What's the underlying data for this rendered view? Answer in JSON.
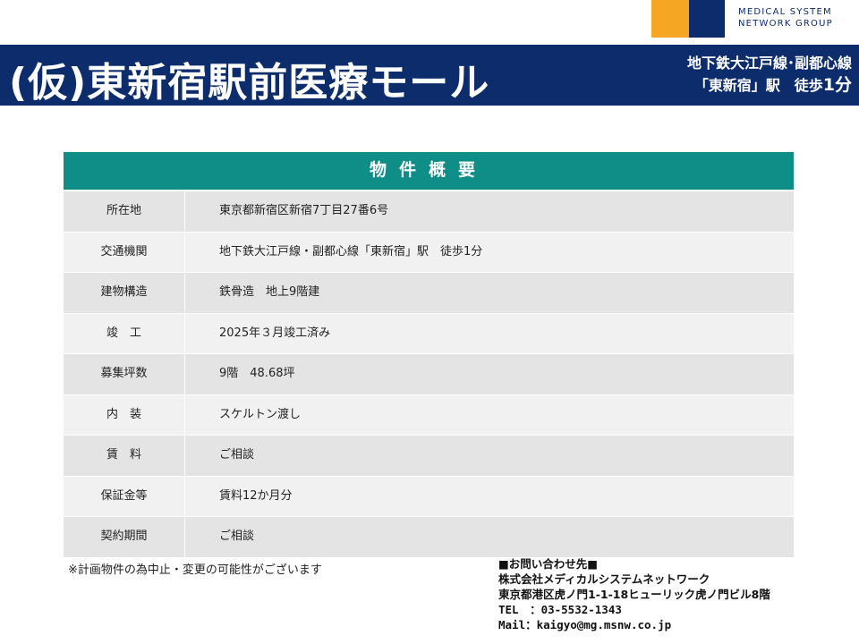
{
  "logo": {
    "line1": "MEDICAL SYSTEM",
    "line2": "NETWORK GROUP",
    "colors": {
      "orange": "#F5A623",
      "navy": "#0D2C6C"
    }
  },
  "banner": {
    "title": "(仮)東新宿駅前医療モール",
    "access_line1": "地下鉄大江戸線･副都心線",
    "access_line2_station": "「東新宿」駅　徒歩",
    "access_line2_minutes": "1分",
    "color": "#0D2C6C"
  },
  "table": {
    "header": "物件概要",
    "header_color": "#0E8E86",
    "rows": [
      {
        "label": "所在地",
        "value": "東京都新宿区新宿7丁目27番6号"
      },
      {
        "label": "交通機関",
        "value": "地下鉄大江戸線・副都心線「東新宿」駅　徒歩1分"
      },
      {
        "label": "建物構造",
        "value": "鉄骨造　地上9階建"
      },
      {
        "label": "竣　工",
        "value": "2025年３月竣工済み"
      },
      {
        "label": "募集坪数",
        "value": "9階　48.68坪"
      },
      {
        "label": "内　装",
        "value": "スケルトン渡し"
      },
      {
        "label": "賃　料",
        "value": "ご相談"
      },
      {
        "label": "保証金等",
        "value": "賃料12か月分"
      },
      {
        "label": "契約期間",
        "value": "ご相談"
      }
    ]
  },
  "note": "※計画物件の為中止・変更の可能性がございます",
  "contact": {
    "heading": "■お問い合わせ先■",
    "company": "株式会社メディカルシステムネットワーク",
    "address": "東京都港区虎ノ門1-1-18ヒューリック虎ノ門ビル8階",
    "tel": "TEL　：03-5532-1343",
    "mail": "Mail：kaigyo@mg.msnw.co.jp"
  }
}
